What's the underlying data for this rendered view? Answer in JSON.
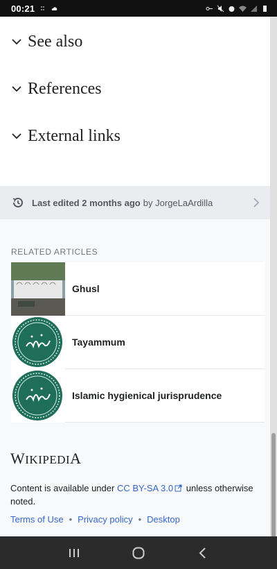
{
  "statusbar": {
    "time": "00:21"
  },
  "sections": [
    {
      "title": "See also"
    },
    {
      "title": "References"
    },
    {
      "title": "External links"
    }
  ],
  "last_edited": {
    "prefix": "Last edited 2 months ago",
    "by": "by JorgeLaArdilla"
  },
  "related": {
    "heading": "RELATED ARTICLES",
    "items": [
      {
        "title": "Ghusl"
      },
      {
        "title": "Tayammum"
      },
      {
        "title": "Islamic hygienical jurisprudence"
      }
    ]
  },
  "footer": {
    "wordmark_first": "W",
    "wordmark_mid": "IKIPEDI",
    "wordmark_last": "A",
    "license_pre": "Content is available under",
    "license_link": "CC BY-SA 3.0",
    "license_post": "unless otherwise noted.",
    "links": [
      "Terms of Use",
      "Privacy policy",
      "Desktop"
    ]
  },
  "colors": {
    "link": "#3366cc",
    "emblem_green": "#1e6e5a"
  }
}
